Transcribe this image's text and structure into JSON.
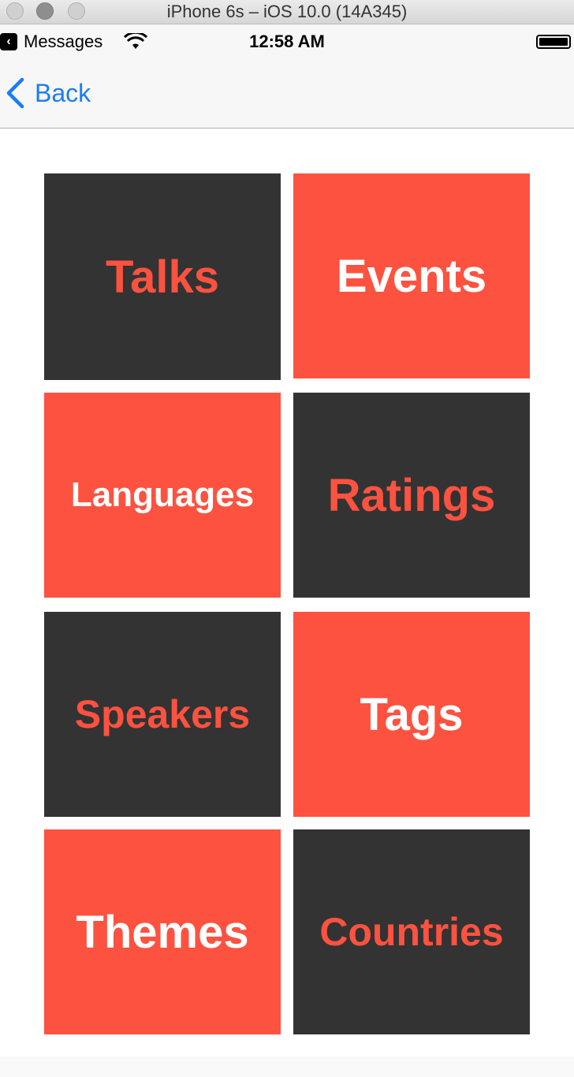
{
  "window": {
    "title": "iPhone 6s – iOS 10.0 (14A345)"
  },
  "statusbar": {
    "back_app_icon": "chevron-left-icon",
    "back_app_label": "Messages",
    "wifi_icon": "wifi-icon",
    "time": "12:58 AM",
    "battery_icon": "battery-icon",
    "battery_level": 1.0
  },
  "navbar": {
    "back_icon": "chevron-left-icon",
    "back_label": "Back"
  },
  "colors": {
    "accent": "#fd5240",
    "dark": "#333333",
    "link_blue": "#1a7cf5"
  },
  "tiles": [
    {
      "label": "Talks",
      "style": "dark"
    },
    {
      "label": "Events",
      "style": "light"
    },
    {
      "label": "Languages",
      "style": "light"
    },
    {
      "label": "Ratings",
      "style": "dark"
    },
    {
      "label": "Speakers",
      "style": "dark"
    },
    {
      "label": "Tags",
      "style": "light"
    },
    {
      "label": "Themes",
      "style": "light"
    },
    {
      "label": "Countries",
      "style": "dark"
    }
  ]
}
